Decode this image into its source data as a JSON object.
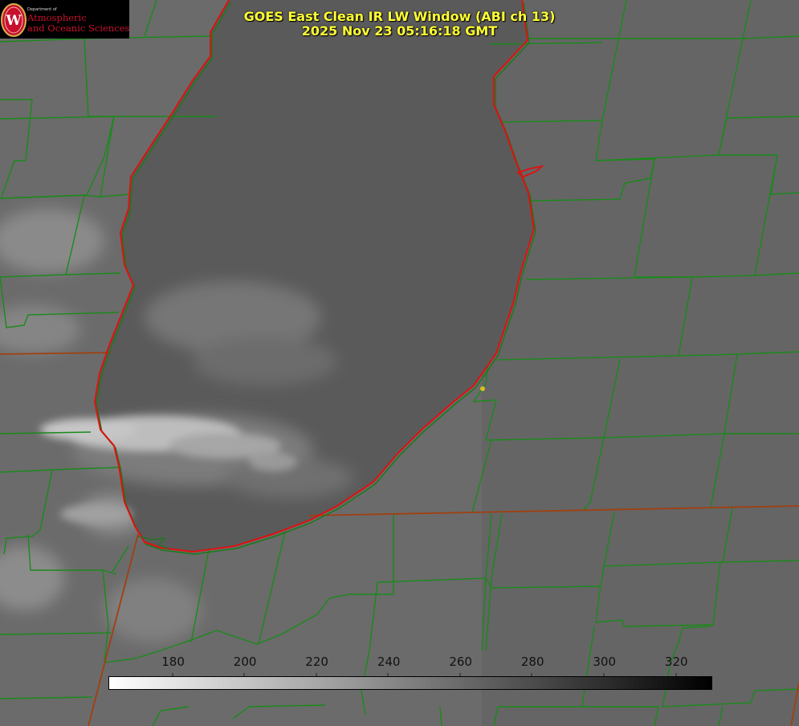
{
  "title": {
    "line1": "GOES East Clean IR LW Window (ABI ch 13)",
    "line2": "2025 Nov 23 05:16:18 GMT"
  },
  "logo": {
    "department": "Department of",
    "line1": "Atmospheric",
    "line2": "and Oceanic Sciences",
    "emblem_letter": "W"
  },
  "colorbar": {
    "tick_labels": [
      "180",
      "200",
      "220",
      "240",
      "260",
      "280",
      "300",
      "320"
    ],
    "tick_values": [
      180,
      200,
      220,
      240,
      260,
      280,
      300,
      320
    ],
    "min": 162,
    "max": 330,
    "low_color": "#ffffff",
    "high_color": "#000000"
  },
  "colors": {
    "title_text": "#ffff33",
    "coastline": "#e01010",
    "county_lines": "#1a8a1a",
    "state_lines": "#a04010",
    "station_marker": "#d4c020",
    "logo_text": "#c8102e"
  }
}
